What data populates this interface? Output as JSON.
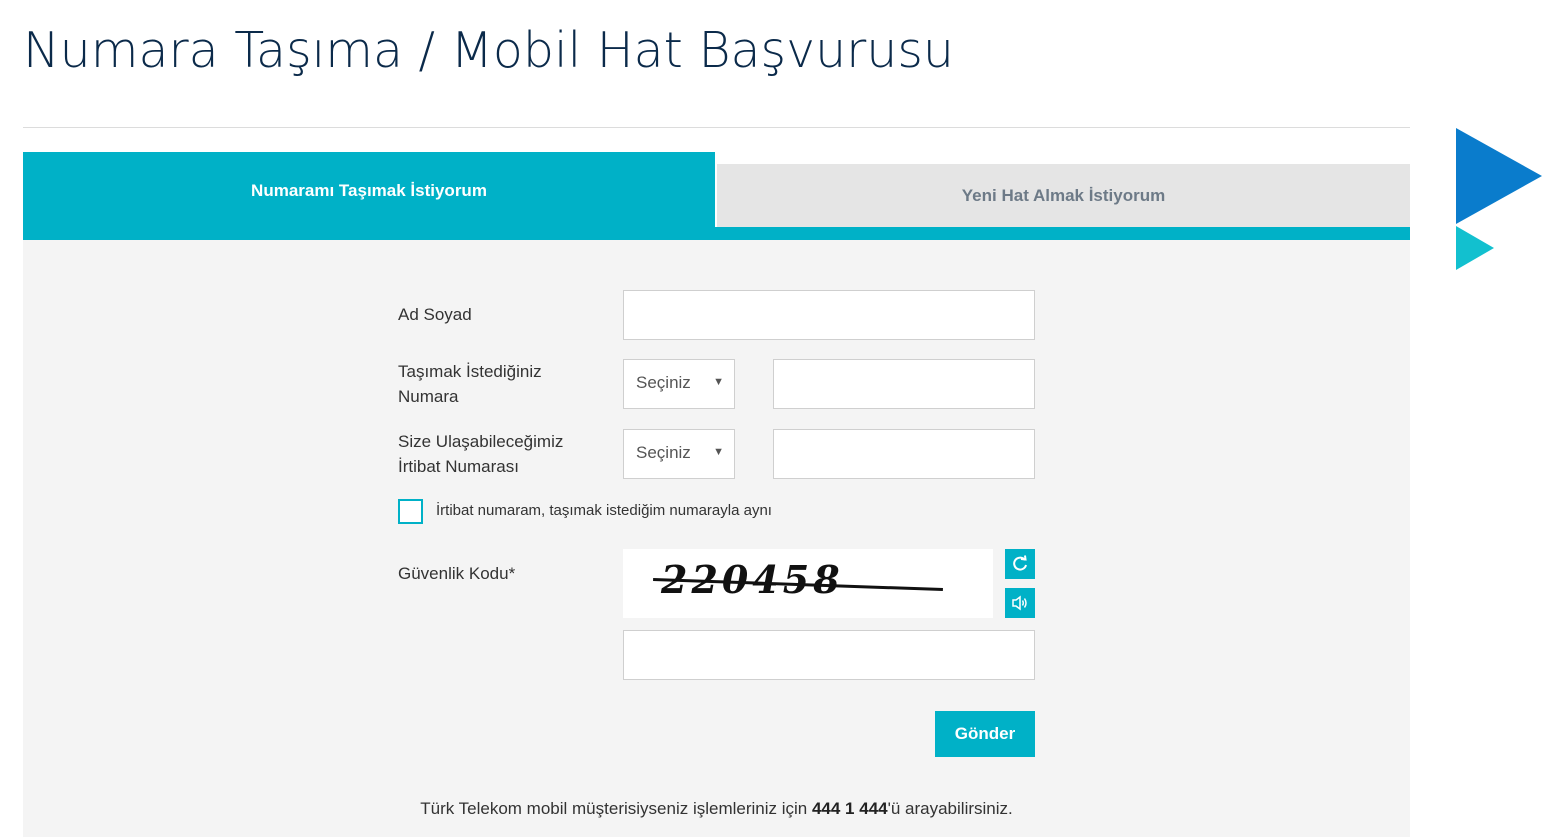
{
  "page": {
    "title": "Numara Taşıma / Mobil Hat Başvurusu"
  },
  "tabs": [
    {
      "label": "Numaramı Taşımak İstiyorum",
      "active": true
    },
    {
      "label": "Yeni Hat Almak İstiyorum",
      "active": false
    }
  ],
  "form": {
    "name_label": "Ad Soyad",
    "name_value": "",
    "port_number_label_line1": "Taşımak İstediğiniz",
    "port_number_label_line2": "Numara",
    "port_prefix_select": "Seçiniz",
    "port_number_value": "",
    "contact_number_label_line1": "Size Ulaşabileceğimiz",
    "contact_number_label_line2": "İrtibat Numarası",
    "contact_prefix_select": "Seçiniz",
    "contact_number_value": "",
    "same_number_checkbox_label": "İrtibat numaram, taşımak istediğim numarayla aynı",
    "same_number_checked": false,
    "captcha_label": "Güvenlik Kodu*",
    "captcha_image_text": "220458",
    "captcha_value": "",
    "submit_label": "Gönder"
  },
  "footer": {
    "prefix": "Türk Telekom mobil müşterisiyseniz işlemleriniz için ",
    "phone": "444 1 444",
    "suffix": "'ü arayabilirsiniz."
  },
  "colors": {
    "accent": "#00b1c7",
    "title": "#0b2a4a",
    "brand_blue": "#0a7ccc",
    "panel_bg": "#f4f4f4"
  }
}
